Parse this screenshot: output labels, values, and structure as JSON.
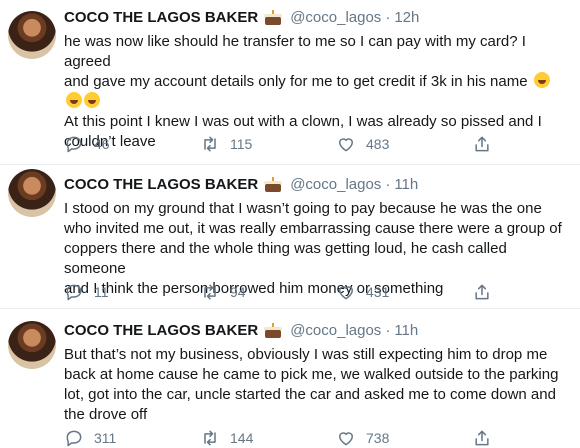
{
  "tweets": [
    {
      "name": "COCO THE LAGOS BAKER",
      "handle": "@coco_lagos",
      "time": "12h",
      "lines": [
        "he was now like should he transfer to me so I can pay with my card? I agreed",
        "and gave my account details only for me to get credit if 3k in his name",
        "",
        "At this point I knew I was out with a clown, I was already so pissed and I",
        "couldn’t leave"
      ],
      "reply_count": "46",
      "retweet_count": "115",
      "like_count": "483"
    },
    {
      "name": "COCO THE LAGOS BAKER",
      "handle": "@coco_lagos",
      "time": "11h",
      "lines": [
        "I stood on my ground that I wasn’t going to pay because he was the one",
        "who invited me out, it was really embarrassing cause there were a group of",
        "coppers there and the whole thing was getting loud, he cash called someone",
        "and I think the person borrowed him money or something"
      ],
      "reply_count": "11",
      "retweet_count": "94",
      "like_count": "431"
    },
    {
      "name": "COCO THE LAGOS BAKER",
      "handle": "@coco_lagos",
      "time": "11h",
      "lines": [
        "But that’s not my business, obviously I was still expecting him to drop me",
        "back at home cause he came to pick me, we walked outside to the parking",
        "lot, got into the car, uncle started the car and asked me to come down and",
        "the drove off"
      ],
      "reply_count": "311",
      "retweet_count": "144",
      "like_count": "738"
    }
  ],
  "separator": "·",
  "icons": {
    "reply": "reply-icon",
    "retweet": "retweet-icon",
    "like": "heart-icon",
    "share": "share-icon",
    "emoji_name": "cake-emoji-icon",
    "emoji_text": "laughing-tears-emoji-icon"
  },
  "colors": {
    "text": "#14171a",
    "secondary": "#657786",
    "divider": "#e6ecf0"
  }
}
